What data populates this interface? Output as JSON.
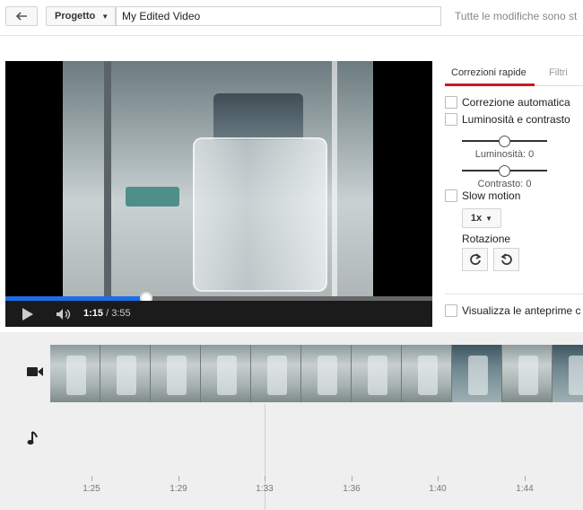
{
  "toolbar": {
    "back_icon": "back-arrow-icon",
    "project_label": "Progetto",
    "title_value": "My Edited Video",
    "save_status": "Tutte le modifiche sono st"
  },
  "player": {
    "current_time": "1:15",
    "separator": " / ",
    "duration": "3:55",
    "progress_fraction": 0.33
  },
  "panel": {
    "tabs": [
      {
        "label": "Correzioni rapide",
        "active": true
      },
      {
        "label": "Filtri",
        "active": false
      }
    ],
    "auto_fix_label": "Correzione automatica",
    "brightness_contrast_label": "Luminosità e contrasto",
    "brightness_label": "Luminosità: 0",
    "brightness_value": 0,
    "contrast_label": "Contrasto: 0",
    "contrast_value": 0,
    "slow_motion_label": "Slow motion",
    "speed_value": "1x",
    "rotation_label": "Rotazione",
    "preview_label": "Visualizza le anteprime c"
  },
  "timeline": {
    "ticks": [
      "1:25",
      "1:29",
      "1:33",
      "1:36",
      "1:40",
      "1:44"
    ],
    "thumbnail_count": 11,
    "dark_thumbs": [
      8,
      10
    ]
  },
  "colors": {
    "progress": "#1c6ee6",
    "tab_accent": "#cc181e"
  }
}
